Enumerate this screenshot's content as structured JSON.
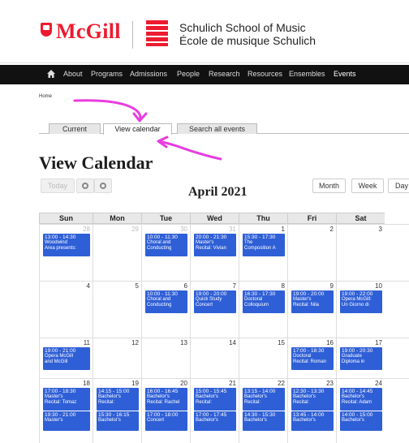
{
  "header": {
    "logo_text": "McGill",
    "school_line1": "Schulich School of Music",
    "school_line2": "École de musique Schulich"
  },
  "nav": {
    "items": [
      "About",
      "Programs",
      "Admissions",
      "People",
      "Research",
      "Resources",
      "Ensembles",
      "Events"
    ]
  },
  "breadcrumb": "Home",
  "tabs": [
    "Current",
    "View calendar",
    "Search all events"
  ],
  "page_title": "View Calendar",
  "toolbar": {
    "today": "Today",
    "month": "Month",
    "week": "Week",
    "day": "Day"
  },
  "month_label": "April 2021",
  "weekdays": [
    "Sun",
    "Mon",
    "Tue",
    "Wed",
    "Thu",
    "Fri",
    "Sat"
  ],
  "weeks": [
    {
      "days": [
        {
          "num": "28",
          "other": true,
          "events": [
            {
              "time": "13:00 - 14:30",
              "lines": [
                "Woodwind",
                "Area presents:"
              ]
            }
          ]
        },
        {
          "num": "29",
          "other": true,
          "events": []
        },
        {
          "num": "30",
          "other": true,
          "events": [
            {
              "time": "10:00 - 11:30",
              "lines": [
                "Choral and",
                "Conducting"
              ]
            }
          ]
        },
        {
          "num": "31",
          "other": true,
          "events": [
            {
              "time": "20:00 - 21:30",
              "lines": [
                "Master's",
                "Recital: Vivian"
              ]
            }
          ]
        },
        {
          "num": "1",
          "other": false,
          "events": [
            {
              "time": "15:30 - 17:30",
              "lines": [
                "The",
                "Composition A"
              ]
            }
          ]
        },
        {
          "num": "2",
          "other": false,
          "events": []
        },
        {
          "num": "3",
          "other": false,
          "events": []
        }
      ]
    },
    {
      "days": [
        {
          "num": "4",
          "other": false,
          "events": []
        },
        {
          "num": "5",
          "other": false,
          "events": []
        },
        {
          "num": "6",
          "other": false,
          "events": [
            {
              "time": "10:00 - 11:30",
              "lines": [
                "Choral and",
                "Conducting"
              ]
            }
          ]
        },
        {
          "num": "7",
          "other": false,
          "events": [
            {
              "time": "19:00 - 20:00",
              "lines": [
                "Quick Study",
                "Concert"
              ]
            }
          ]
        },
        {
          "num": "8",
          "other": false,
          "events": [
            {
              "time": "16:30 - 17:30",
              "lines": [
                "Doctoral",
                "Colloquium"
              ]
            }
          ]
        },
        {
          "num": "9",
          "other": false,
          "events": [
            {
              "time": "19:00 - 20:00",
              "lines": [
                "Master's",
                "Recital: Nila"
              ]
            }
          ]
        },
        {
          "num": "10",
          "other": false,
          "events": [
            {
              "time": "19:00 - 22:00",
              "lines": [
                "Opera McGill:",
                "Un Giorno di"
              ]
            }
          ]
        }
      ]
    },
    {
      "days": [
        {
          "num": "11",
          "other": false,
          "events": [
            {
              "time": "19:00 - 21:00",
              "lines": [
                "Opera McGill",
                "and McGill"
              ]
            }
          ]
        },
        {
          "num": "12",
          "other": false,
          "events": []
        },
        {
          "num": "13",
          "other": false,
          "events": []
        },
        {
          "num": "14",
          "other": false,
          "events": []
        },
        {
          "num": "15",
          "other": false,
          "events": []
        },
        {
          "num": "16",
          "other": false,
          "events": [
            {
              "time": "17:00 - 18:30",
              "lines": [
                "Doctoral",
                "Recital: Roman"
              ]
            }
          ]
        },
        {
          "num": "17",
          "other": false,
          "events": [
            {
              "time": "19:00 - 20:30",
              "lines": [
                "Graduate",
                "Diploma in"
              ]
            }
          ]
        }
      ]
    },
    {
      "days": [
        {
          "num": "18",
          "other": false,
          "events": [
            {
              "time": "17:00 - 18:30",
              "lines": [
                "Master's",
                "Recital: Tomaz"
              ]
            },
            {
              "time": "19:30 - 21:00",
              "lines": [
                "Master's"
              ]
            }
          ]
        },
        {
          "num": "19",
          "other": false,
          "events": [
            {
              "time": "14:15 - 15:00",
              "lines": [
                "Bachelor's",
                "Recital:"
              ]
            },
            {
              "time": "15:30 - 16:15",
              "lines": [
                "Bachelor's"
              ]
            }
          ]
        },
        {
          "num": "20",
          "other": false,
          "events": [
            {
              "time": "16:00 - 16:45",
              "lines": [
                "Bachelor's",
                "Recital: Rachel"
              ]
            },
            {
              "time": "17:00 - 18:00",
              "lines": [
                "Concert"
              ]
            }
          ]
        },
        {
          "num": "21",
          "other": false,
          "events": [
            {
              "time": "15:00 - 15:45",
              "lines": [
                "Bachelor's",
                "Recital:"
              ]
            },
            {
              "time": "17:00 - 17:45",
              "lines": [
                "Bachelor's"
              ]
            }
          ]
        },
        {
          "num": "22",
          "other": false,
          "events": [
            {
              "time": "13:15 - 14:00",
              "lines": [
                "Bachelor's",
                "Recital:"
              ]
            },
            {
              "time": "14:30 - 15:30",
              "lines": [
                "Bachelor's"
              ]
            }
          ]
        },
        {
          "num": "23",
          "other": false,
          "events": [
            {
              "time": "12:30 - 13:30",
              "lines": [
                "Bachelor's",
                "Recital:"
              ]
            },
            {
              "time": "13:45 - 14:00",
              "lines": [
                "Bachelor's"
              ]
            }
          ]
        },
        {
          "num": "24",
          "other": false,
          "events": [
            {
              "time": "14:00 - 14:45",
              "lines": [
                "Bachelor's",
                "Recital: Adam"
              ]
            },
            {
              "time": "14:00 - 15:00",
              "lines": [
                "Bachelor's"
              ]
            }
          ]
        }
      ]
    }
  ],
  "colors": {
    "brand_red": "#ed1b2f",
    "event_blue": "#2f5fd6",
    "annotation_magenta": "#e83ce0",
    "nav_black": "#111111"
  }
}
